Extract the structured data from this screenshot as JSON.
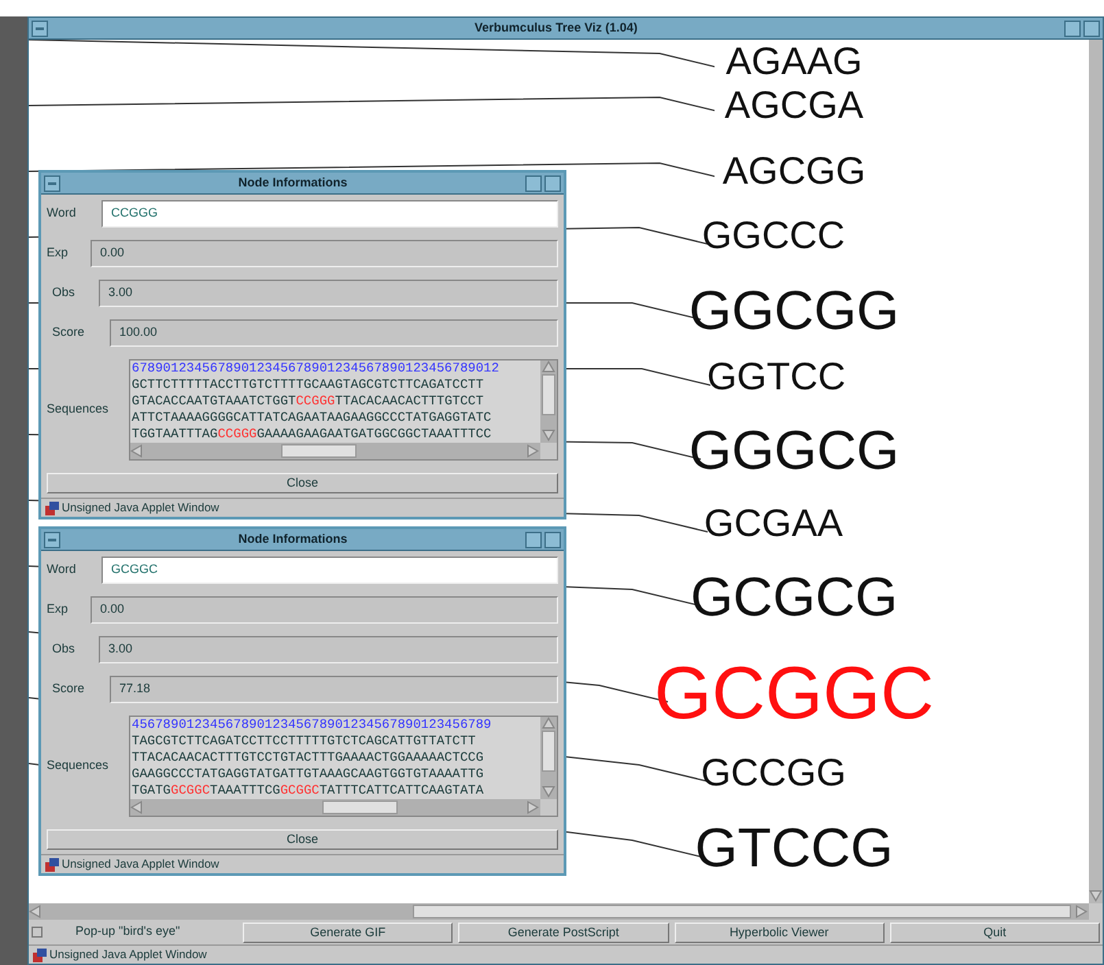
{
  "window": {
    "title": "Verbumculus Tree Viz (1.04)"
  },
  "tree": {
    "nodes": [
      {
        "word": "AGAAG",
        "kind": "small",
        "highlighted": false
      },
      {
        "word": "AGCGA",
        "kind": "small",
        "highlighted": false
      },
      {
        "word": "AGCGG",
        "kind": "small",
        "highlighted": false
      },
      {
        "word": "GGCCC",
        "kind": "small",
        "highlighted": false
      },
      {
        "word": "GGCGG",
        "kind": "large",
        "highlighted": false
      },
      {
        "word": "GGTCC",
        "kind": "small",
        "highlighted": false
      },
      {
        "word": "GGGCG",
        "kind": "large",
        "highlighted": false
      },
      {
        "word": "GCGAA",
        "kind": "small",
        "highlighted": false
      },
      {
        "word": "GCGCG",
        "kind": "large",
        "highlighted": false
      },
      {
        "word": "GCGGC",
        "kind": "xlarge",
        "highlighted": true
      },
      {
        "word": "GCCGG",
        "kind": "small",
        "highlighted": false
      },
      {
        "word": "GTCCG",
        "kind": "large",
        "highlighted": false
      }
    ]
  },
  "dialogs": [
    {
      "title": "Node Informations",
      "word_label": "Word",
      "word": "CCGGG",
      "exp_label": "Exp",
      "exp": "0.00",
      "obs_label": "Obs",
      "obs": "3.00",
      "score_label": "Score",
      "score": "100.00",
      "sequences_label": "Sequences",
      "sequences": [
        [
          {
            "text": "67890123456789012345678901234567890123456789012",
            "kind": "ruler"
          }
        ],
        [
          {
            "text": "GCTTCTTTTTACCTTGTCTTTTGCAAGTAGCGTCTTCAGATCCTT",
            "kind": "plain"
          }
        ],
        [
          {
            "text": "GTACACCAATGTAAATCTGGT",
            "kind": "plain"
          },
          {
            "text": "CCGGG",
            "kind": "match"
          },
          {
            "text": "TTACACAACACTTTGTCCT",
            "kind": "plain"
          }
        ],
        [
          {
            "text": "ATTCTAAAAGGGGCATTATCAGAATAAGAAGGCCCTATGAGGTATC",
            "kind": "plain"
          }
        ],
        [
          {
            "text": "TGGTAATTTAG",
            "kind": "plain"
          },
          {
            "text": "CCGGG",
            "kind": "match"
          },
          {
            "text": "GAAAAGAAGAATGATGGCGGCTAAATTTCC",
            "kind": "plain"
          }
        ]
      ],
      "close": "Close",
      "status": "Unsigned Java Applet Window"
    },
    {
      "title": "Node Informations",
      "word_label": "Word",
      "word": "GCGGC",
      "exp_label": "Exp",
      "exp": "0.00",
      "obs_label": "Obs",
      "obs": "3.00",
      "score_label": "Score",
      "score": "77.18",
      "sequences_label": "Sequences",
      "sequences": [
        [
          {
            "text": "4567890123456789012345678901234567890123456789",
            "kind": "ruler"
          }
        ],
        [
          {
            "text": "TAGCGTCTTCAGATCCTTCCTTTTTGTCTCAGCATTGTTATCTT",
            "kind": "plain"
          }
        ],
        [
          {
            "text": "TTACACAACACTTTGTCCTGTACTTTGAAAACTGGAAAAACTCCG",
            "kind": "plain"
          }
        ],
        [
          {
            "text": "GAAGGCCCTATGAGGTATGATTGTAAAGCAAGTGGTGTAAAATTG",
            "kind": "plain"
          }
        ],
        [
          {
            "text": "TGATG",
            "kind": "plain"
          },
          {
            "text": "GCGGC",
            "kind": "match"
          },
          {
            "text": "TAAATTTCG",
            "kind": "plain"
          },
          {
            "text": "GCGGC",
            "kind": "match"
          },
          {
            "text": "TATTTCATTCATTCAAGTATA",
            "kind": "plain"
          }
        ]
      ],
      "close": "Close",
      "status": "Unsigned Java Applet Window"
    }
  ],
  "toolbar": {
    "checkbox": {
      "label": "Pop-up \"bird's eye\"",
      "checked": false
    },
    "buttons": [
      "Generate GIF",
      "Generate PostScript",
      "Hyperbolic Viewer",
      "Quit"
    ]
  },
  "status_bar": "Unsigned Java Applet Window"
}
